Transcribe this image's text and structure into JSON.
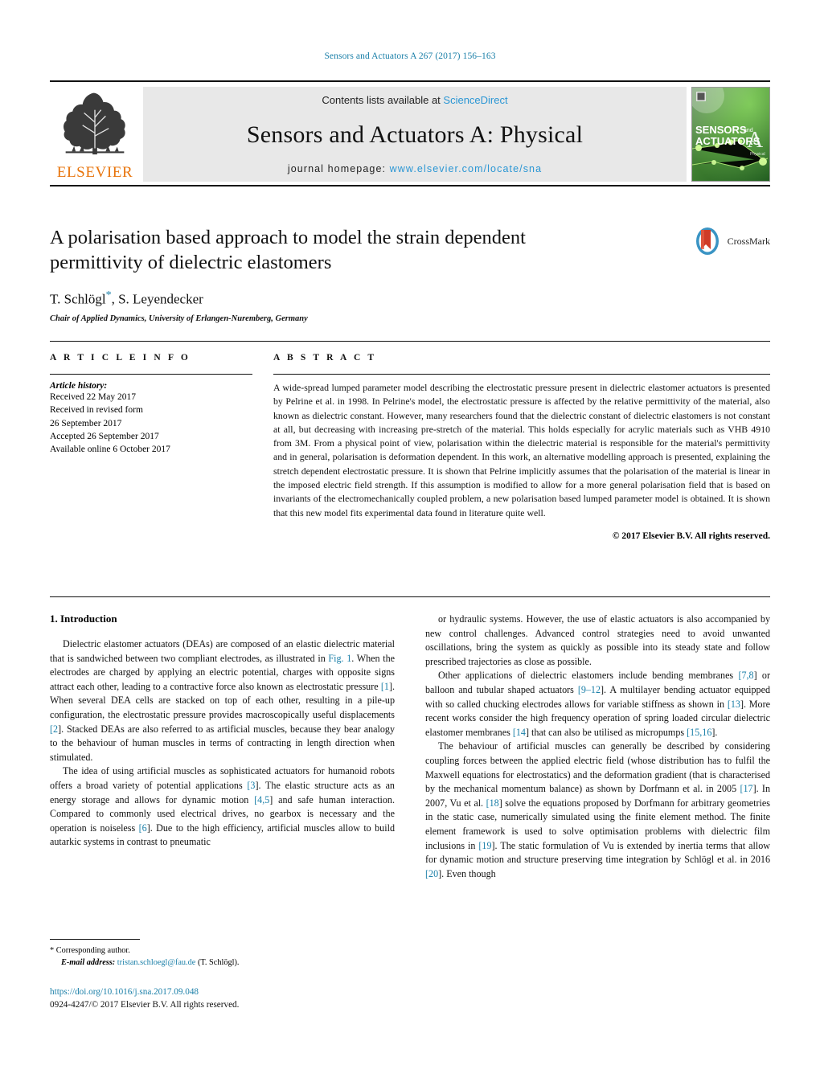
{
  "running_head": "Sensors and Actuators A 267 (2017) 156–163",
  "masthead": {
    "contents_prefix": "Contents lists available at ",
    "contents_link": "ScienceDirect",
    "journal_name": "Sensors and Actuators A: Physical",
    "homepage_prefix": "journal homepage: ",
    "homepage_url": "www.elsevier.com/locate/sna",
    "publisher_wordmark": "ELSEVIER",
    "cover_line1": "SENSORS",
    "cover_and": "and",
    "cover_line2": "ACTUATORS",
    "cover_letter": "A",
    "cover_sub": "Physical"
  },
  "article": {
    "title": "A polarisation based approach to model the strain dependent permittivity of dielectric elastomers",
    "authors": "T. Schlögl",
    "authors_star": "*",
    "authors_rest": ", S. Leyendecker",
    "affiliation": "Chair of Applied Dynamics, University of Erlangen-Nuremberg, Germany",
    "crossmark_label": "CrossMark"
  },
  "article_info": {
    "heading": "A R T I C L E   I N F O",
    "history_label": "Article history:",
    "history": [
      "Received 22 May 2017",
      "Received in revised form",
      "26 September 2017",
      "Accepted 26 September 2017",
      "Available online 6 October 2017"
    ]
  },
  "abstract": {
    "heading": "A B S T R A C T",
    "text": "A wide-spread lumped parameter model describing the electrostatic pressure present in dielectric elastomer actuators is presented by Pelrine et al. in 1998. In Pelrine's model, the electrostatic pressure is affected by the relative permittivity of the material, also known as dielectric constant. However, many researchers found that the dielectric constant of dielectric elastomers is not constant at all, but decreasing with increasing pre-stretch of the material. This holds especially for acrylic materials such as VHB 4910 from 3M. From a physical point of view, polarisation within the dielectric material is responsible for the material's permittivity and in general, polarisation is deformation dependent. In this work, an alternative modelling approach is presented, explaining the stretch dependent electrostatic pressure. It is shown that Pelrine implicitly assumes that the polarisation of the material is linear in the imposed electric field strength. If this assumption is modified to allow for a more general polarisation field that is based on invariants of the electromechanically coupled problem, a new polarisation based lumped parameter model is obtained. It is shown that this new model fits experimental data found in literature quite well.",
    "copyright": "© 2017 Elsevier B.V. All rights reserved."
  },
  "body": {
    "section_number_title": "1.  Introduction",
    "left_paragraphs": [
      "Dielectric elastomer actuators (DEAs) are composed of an elastic dielectric material that is sandwiched between two compliant electrodes, as illustrated in [[Fig. 1]]. When the electrodes are charged by applying an electric potential, charges with opposite signs attract each other, leading to a contractive force also known as electrostatic pressure [[[1]]]. When several DEA cells are stacked on top of each other, resulting in a pile-up configuration, the electrostatic pressure provides macroscopically useful displacements [[[2]]]. Stacked DEAs are also referred to as artificial muscles, because they bear analogy to the behaviour of human muscles in terms of contracting in length direction when stimulated.",
      "The idea of using artificial muscles as sophisticated actuators for humanoid robots offers a broad variety of potential applications [[[3]]]. The elastic structure acts as an energy storage and allows for dynamic motion [[[4,5]]] and safe human interaction. Compared to commonly used electrical drives, no gearbox is necessary and the operation is noiseless [[[6]]]. Due to the high efficiency, artificial muscles allow to build autarkic systems in contrast to pneumatic"
    ],
    "right_paragraphs": [
      "or hydraulic systems. However, the use of elastic actuators is also accompanied by new control challenges. Advanced control strategies need to avoid unwanted oscillations, bring the system as quickly as possible into its steady state and follow prescribed trajectories as close as possible.",
      "Other applications of dielectric elastomers include bending membranes [[[7,8]]] or balloon and tubular shaped actuators [[[9–12]]]. A multilayer bending actuator equipped with so called chucking electrodes allows for variable stiffness as shown in [[[13]]]. More recent works consider the high frequency operation of spring loaded circular dielectric elastomer membranes [[[14]]] that can also be utilised as micropumps [[[15,16]]].",
      "The behaviour of artificial muscles can generally be described by considering coupling forces between the applied electric field (whose distribution has to fulfil the Maxwell equations for electrostatics) and the deformation gradient (that is characterised by the mechanical momentum balance) as shown by Dorfmann et al. in 2005 [[[17]]]. In 2007, Vu et al. [[[18]]] solve the equations proposed by Dorfmann for arbitrary geometries in the static case, numerically simulated using the finite element method. The finite element framework is used to solve optimisation problems with dielectric film inclusions in [[[19]]]. The static formulation of Vu is extended by inertia terms that allow for dynamic motion and structure preserving time integration by Schlögl et al. in 2016 [[[20]]]. Even though"
    ]
  },
  "footnote": {
    "corresponding_marker": "*",
    "corresponding_text": "Corresponding author.",
    "email_label": "E-mail address:",
    "email": "tristan.schloegl@fau.de",
    "email_suffix": "(T. Schlögl).",
    "doi": "https://doi.org/10.1016/j.sna.2017.09.048",
    "issn_copyright": "0924-4247/© 2017 Elsevier B.V. All rights reserved."
  },
  "colors": {
    "link_blue": "#1a7fa8",
    "sciencedirect_blue": "#2a96d4",
    "elsevier_orange": "#E8740C",
    "band_gray": "#e8e8e8"
  }
}
